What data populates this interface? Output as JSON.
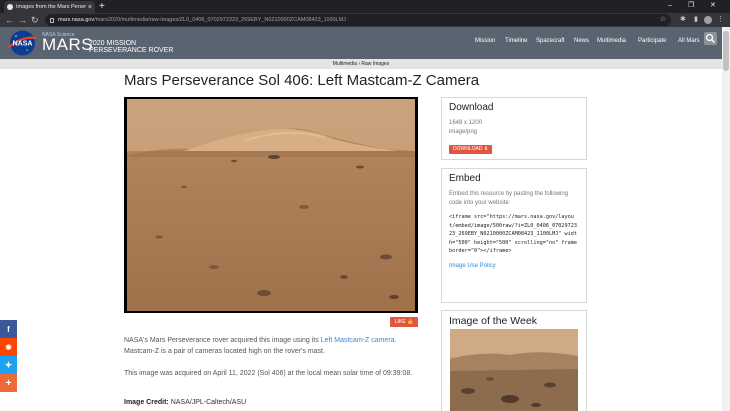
{
  "browser": {
    "tab_title": "Images from the Mars Perseverance",
    "tab_close": "×",
    "new_tab": "+",
    "url_host": "mars.nasa.gov",
    "url_path": "/mars2020/multimedia/raw-images/ZL0_0406_0702972323_269EBY_N0210000ZCAM08423_1100LMJ",
    "win_min": "–",
    "win_max": "❐",
    "win_close": "✕"
  },
  "header": {
    "logo_text": "NASA",
    "brand_small": "NASA Science",
    "brand_mars": "MARS",
    "brand_mission": "2020 MISSION",
    "brand_rover": "PERSEVERANCE ROVER",
    "menu": [
      "Mission",
      "Timeline",
      "Spacecraft",
      "News",
      "Multimedia",
      "Participate",
      "All Mars"
    ]
  },
  "subnav": {
    "label": "Multimedia › Raw Images"
  },
  "main": {
    "title": "Mars Perseverance Sol 406: Left Mastcam-Z Camera",
    "like_label": "LIKE 👍",
    "para1_a": "NASA's Mars Perseverance rover acquired this image using its ",
    "para1_link": "Left Mastcam-Z camera",
    "para1_b": ". Mastcam-Z is a pair of cameras located high on the rover's mast.",
    "para2": "This image was acquired on April 11, 2022 (Sol 406) at the local mean solar time of 09:39:08.",
    "credit_label": "Image Credit:",
    "credit_value": "NASA/JPL-Caltech/ASU"
  },
  "download": {
    "title": "Download",
    "dimensions": "1648 x 1200",
    "format": "image/png",
    "button": "DOWNLOAD"
  },
  "embed": {
    "title": "Embed",
    "text": "Embed this resource by pasting the following code into your website:",
    "code": "<iframe src=\"https://mars.nasa.gov/layout/embed/image/500raw/?i=ZL0_0406_0702972323_269EBY_N0210000ZCAM08423_1100LMJ\" width=\"500\" height=\"500\" scrolling=\"no\" frameborder=\"0\"></iframe>",
    "policy": "Image Use Policy"
  },
  "iotw": {
    "title": "Image of the Week"
  },
  "share": [
    {
      "icon": "facebook-icon",
      "glyph": "f",
      "color": "#3b5998"
    },
    {
      "icon": "reddit-icon",
      "glyph": "◉",
      "color": "#ff4500"
    },
    {
      "icon": "twitter-icon",
      "glyph": "🐦",
      "color": "#1da1f2"
    },
    {
      "icon": "plus-icon",
      "glyph": "+",
      "color": "#f06a35"
    }
  ]
}
